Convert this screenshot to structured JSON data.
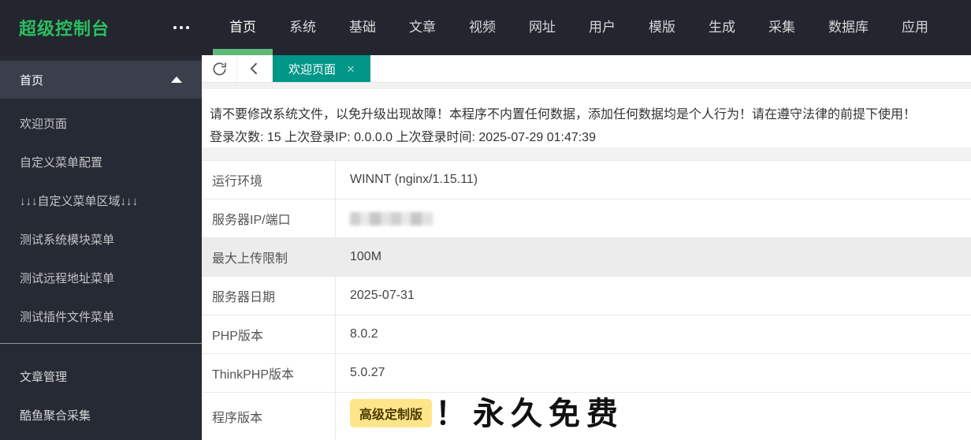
{
  "brand": {
    "logo": "超级控制台"
  },
  "topnav": {
    "items": [
      {
        "label": "首页",
        "active": true
      },
      {
        "label": "系统"
      },
      {
        "label": "基础"
      },
      {
        "label": "文章"
      },
      {
        "label": "视频"
      },
      {
        "label": "网址"
      },
      {
        "label": "用户"
      },
      {
        "label": "模版"
      },
      {
        "label": "生成"
      },
      {
        "label": "采集"
      },
      {
        "label": "数据库"
      },
      {
        "label": "应用"
      }
    ]
  },
  "sidebar": {
    "group_label": "首页",
    "items": [
      {
        "label": "欢迎页面"
      },
      {
        "label": "自定义菜单配置"
      },
      {
        "label": "↓↓↓自定义菜单区域↓↓↓"
      },
      {
        "label": "测试系统模块菜单"
      },
      {
        "label": "测试远程地址菜单"
      },
      {
        "label": "测试插件文件菜单"
      }
    ],
    "sections": [
      {
        "label": "文章管理"
      },
      {
        "label": "酷鱼聚合采集"
      }
    ]
  },
  "tabbar": {
    "active_tab": "欢迎页面",
    "close_glyph": "×"
  },
  "notice": {
    "line1": "请不要修改系统文件，以免升级出现故障！本程序不内置任何数据，添加任何数据均是个人行为！请在遵守法律的前提下使用！",
    "line2": "登录次数: 15 上次登录IP: 0.0.0.0 上次登录时间: 2025-07-29 01:47:39"
  },
  "info_table": {
    "rows": [
      {
        "label": "运行环境",
        "value": "WINNT (nginx/1.15.11)"
      },
      {
        "label": "服务器IP/端口",
        "value": ""
      },
      {
        "label": "最大上传限制",
        "value": "100M"
      },
      {
        "label": "服务器日期",
        "value": "2025-07-31"
      },
      {
        "label": "PHP版本",
        "value": "8.0.2"
      },
      {
        "label": "ThinkPHP版本",
        "value": "5.0.27"
      },
      {
        "label": "程序版本",
        "badge": "高级定制版",
        "value": "！永久免费"
      }
    ]
  },
  "colors": {
    "header_bg": "#23262E",
    "sidebar_bg": "#262A34",
    "sidebar_group_bg": "#3A3F4B",
    "logo_green": "#2BBE60",
    "nav_underline_green": "#5FB878",
    "tab_teal": "#009688",
    "badge_yellow": "#FFE58A",
    "row_gray": "#ececec"
  }
}
